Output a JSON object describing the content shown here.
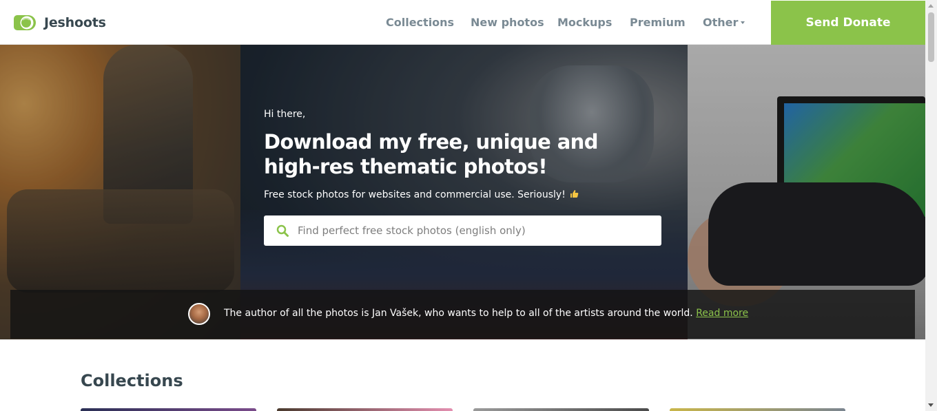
{
  "brand": {
    "name": "Jeshoots",
    "accent_color": "#8bc34a"
  },
  "nav": {
    "items": [
      {
        "label": "Collections"
      },
      {
        "label": "New photos"
      },
      {
        "label": "Mockups"
      },
      {
        "label": "Premium"
      },
      {
        "label": "Other",
        "has_dropdown": true
      }
    ],
    "donate_label": "Send Donate"
  },
  "hero": {
    "greeting": "Hi there,",
    "headline_line1": "Download my free, unique and",
    "headline_line2": "high-res thematic photos!",
    "subtitle": "Free stock photos for websites and commercial use. Seriously!",
    "subtitle_icon": "thumbs-up-icon",
    "search": {
      "placeholder": "Find perfect free stock photos (english only)",
      "value": "",
      "icon": "search-icon"
    }
  },
  "author_bar": {
    "text": "The author of all the photos is Jan Vašek, who wants to help to all of the artists around the world.",
    "link_label": "Read more"
  },
  "collections": {
    "title": "Collections"
  }
}
